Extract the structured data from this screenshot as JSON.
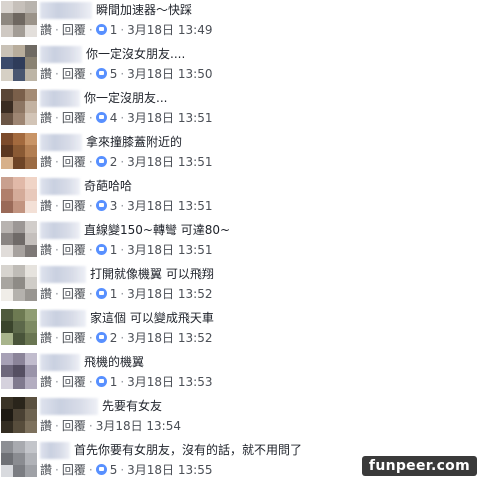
{
  "comments": [
    {
      "text": "瞬間加速器～快踩",
      "action_read": "讚",
      "action_reply": "回覆",
      "likes": "1",
      "date": "3月18日 13:49",
      "has_likes": true
    },
    {
      "text": "你一定沒女朋友....",
      "action_read": "讚",
      "action_reply": "回覆",
      "likes": "5",
      "date": "3月18日 13:50",
      "has_likes": true
    },
    {
      "text": "你一定沒朋友...",
      "action_read": "讚",
      "action_reply": "回覆",
      "likes": "4",
      "date": "3月18日 13:51",
      "has_likes": true
    },
    {
      "text": "拿來撞膝蓋附近的",
      "action_read": "讚",
      "action_reply": "回覆",
      "likes": "2",
      "date": "3月18日 13:51",
      "has_likes": true
    },
    {
      "text": "奇葩哈哈",
      "action_read": "讚",
      "action_reply": "回覆",
      "likes": "3",
      "date": "3月18日 13:51",
      "has_likes": true
    },
    {
      "text": "直線變150~轉彎 可達80~",
      "action_read": "讚",
      "action_reply": "回覆",
      "likes": "1",
      "date": "3月18日 13:51",
      "has_likes": true
    },
    {
      "text": "打開就像機翼 可以飛翔",
      "action_read": "讚",
      "action_reply": "回覆",
      "likes": "1",
      "date": "3月18日 13:52",
      "has_likes": true
    },
    {
      "text": "家這個 可以變成飛天車",
      "action_read": "讚",
      "action_reply": "回覆",
      "likes": "2",
      "date": "3月18日 13:52",
      "has_likes": true
    },
    {
      "text": "飛機的機翼",
      "action_read": "讚",
      "action_reply": "回覆",
      "likes": "1",
      "date": "3月18日 13:53",
      "has_likes": true
    },
    {
      "text": "先要有女友",
      "action_read": "讚",
      "action_reply": "回覆",
      "likes": "",
      "date": "3月18日 13:54",
      "has_likes": false
    },
    {
      "text": "首先你要有女朋友，沒有的話，就不用問了",
      "action_read": "讚",
      "action_reply": "回覆",
      "likes": "5",
      "date": "3月18日 13:55",
      "has_likes": true
    }
  ],
  "watermark": "funpeer.com",
  "colors": {
    "like_blue": "#5890ff",
    "meta_gray": "#4b4f56",
    "text": "#1d2129"
  }
}
